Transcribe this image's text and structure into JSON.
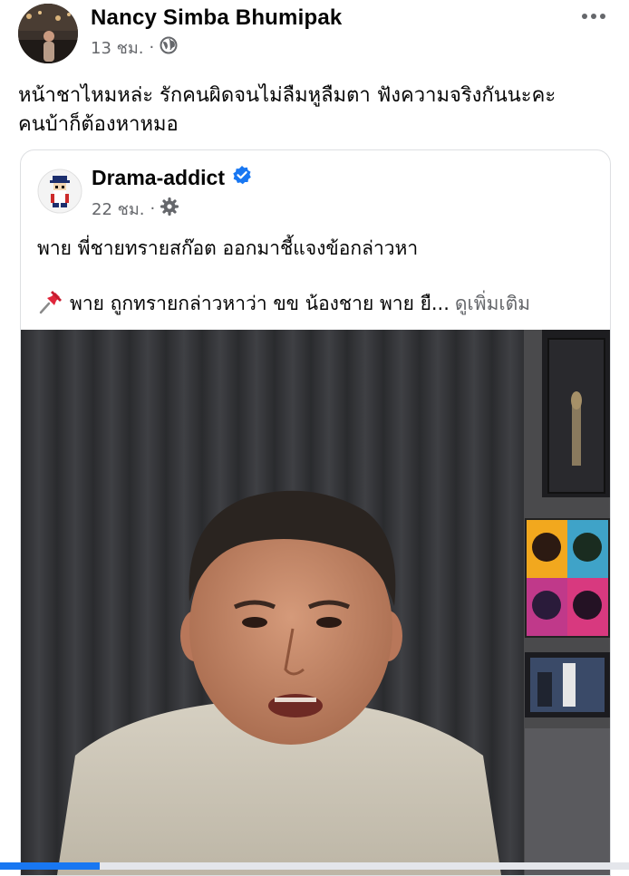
{
  "post": {
    "author": "Nancy Simba Bhumipak",
    "time": "13 ชม.",
    "separator": "·",
    "audience_icon": "globe-icon",
    "more_icon": "more-horizontal-icon",
    "text_line1": "หน้าชาไหมหล่ะ รักคนผิดจนไม่ลืมหูลืมตา ฟังความจริงกันนะคะ",
    "text_line2": "คนบ้าก็ต้องหาหมอ"
  },
  "shared_post": {
    "author": "Drama-addict",
    "verified_icon": "verified-badge-icon",
    "time": "22 ชม.",
    "separator": "·",
    "audience_icon": "gear-icon",
    "headline": "พาย พี่ชายทรายสก๊อต ออกมาชี้แจงข้อกล่าวหา",
    "pin_icon": "pushpin-icon",
    "body": "พาย ถูกทรายกล่าวหาว่า ขข น้องชาย พาย ยื...",
    "see_more": "ดูเพิ่มเติม"
  },
  "colors": {
    "text": "#050505",
    "secondary": "#65676b",
    "verified": "#1877f2",
    "card_border": "#dddfe2"
  }
}
